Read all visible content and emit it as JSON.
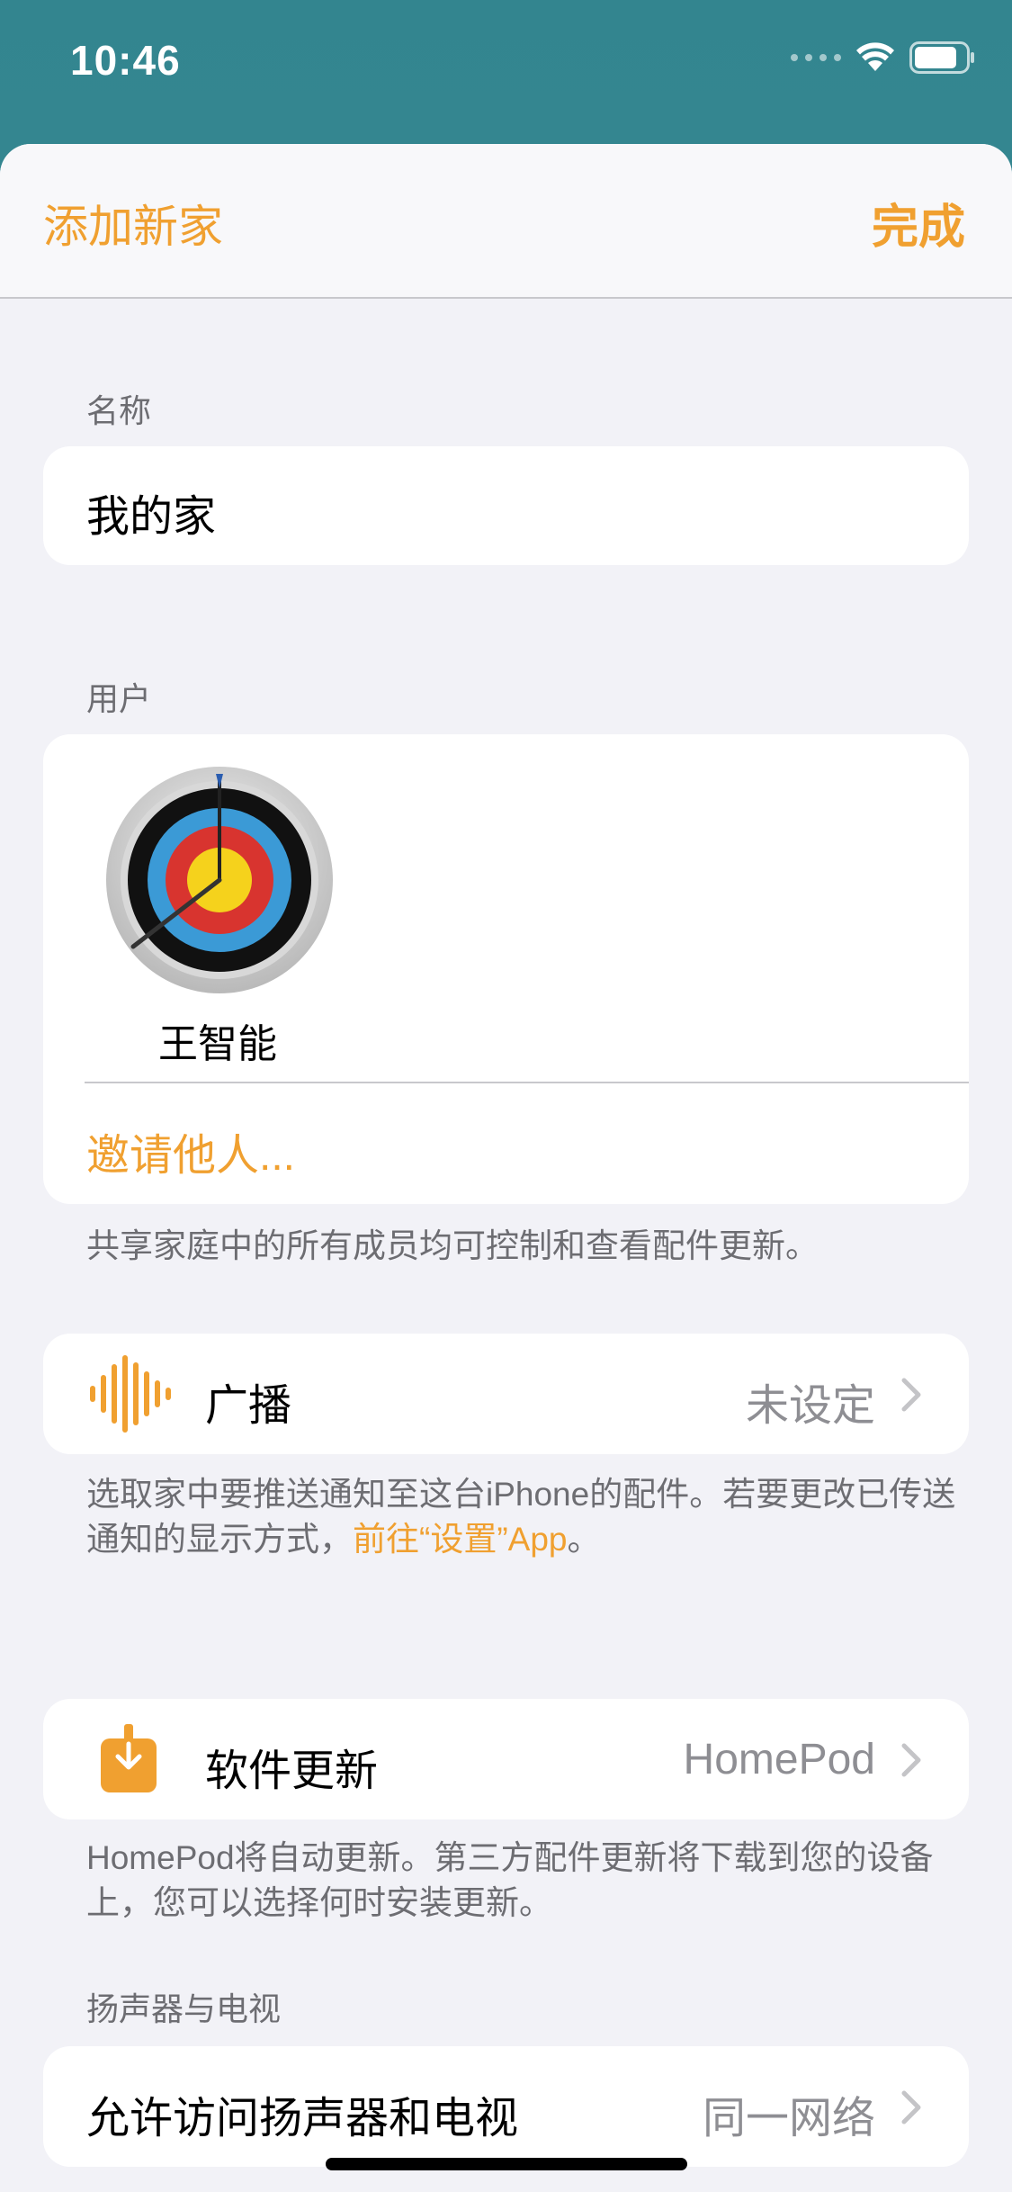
{
  "status_bar": {
    "time": "10:46"
  },
  "nav": {
    "title": "添加新家",
    "done_label": "完成"
  },
  "name_section": {
    "header": "名称",
    "value": "我的家"
  },
  "users_section": {
    "header": "用户",
    "user_name": "王智能",
    "invite_label": "邀请他人...",
    "footer": "共享家庭中的所有成员均可控制和查看配件更新。"
  },
  "announce_section": {
    "label": "广播",
    "value": "未设定",
    "footer_part1": "选取家中要推送通知至这台iPhone的配件。若要更改已传送通知的显示方式，",
    "footer_link": "前往“设置”App",
    "footer_part2": "。"
  },
  "update_section": {
    "label": "软件更新",
    "value": "HomePod",
    "footer": "HomePod将自动更新。第三方配件更新将下载到您的设备上，您可以选择何时安装更新。"
  },
  "speakers_section": {
    "header": "扬声器与电视",
    "label": "允许访问扬声器和电视",
    "value": "同一网络"
  },
  "colors": {
    "accent": "#f0a030",
    "sheet_bg": "#f2f2f7",
    "card_bg": "#ffffff",
    "secondary_text": "#6d6d72"
  },
  "icons": {
    "announce": "waveform-icon",
    "update": "download-box-icon",
    "avatar": "archery-target-avatar"
  }
}
